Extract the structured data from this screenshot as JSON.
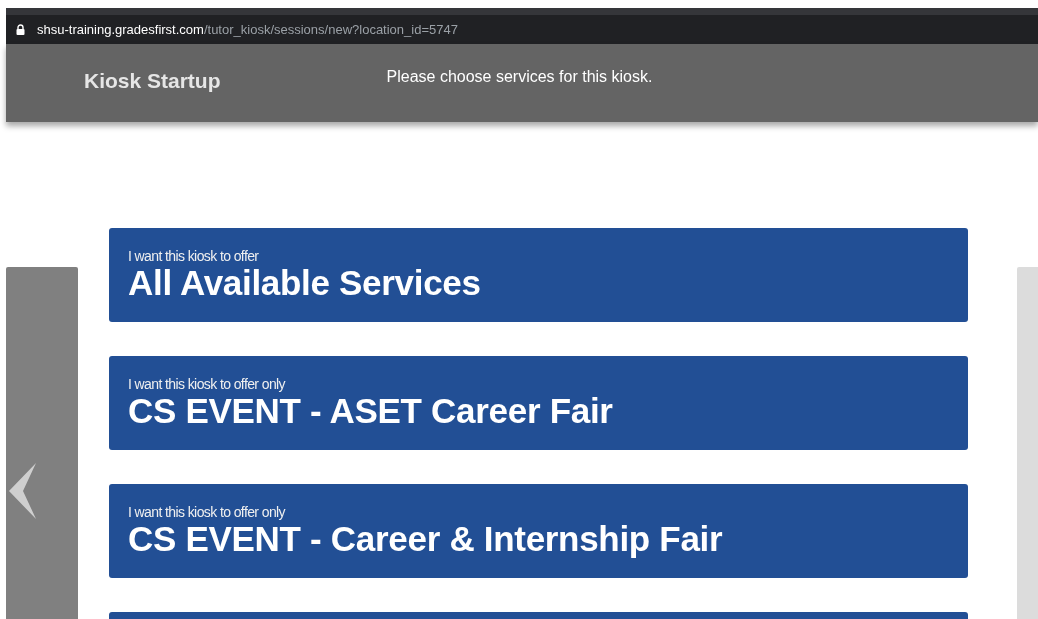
{
  "address_bar": {
    "host": "shsu-training.gradesfirst.com",
    "path": "/tutor_kiosk/sessions/new?location_id=5747"
  },
  "header": {
    "title": "Kiosk Startup",
    "instruction": "Please choose services for this kiosk."
  },
  "services": [
    {
      "intro": "I want this kiosk to offer",
      "name": "All Available Services"
    },
    {
      "intro": "I want this kiosk to offer only",
      "name": "CS EVENT - ASET Career Fair"
    },
    {
      "intro": "I want this kiosk to offer only",
      "name": "CS EVENT - Career & Internship Fair"
    }
  ],
  "more_below": true
}
